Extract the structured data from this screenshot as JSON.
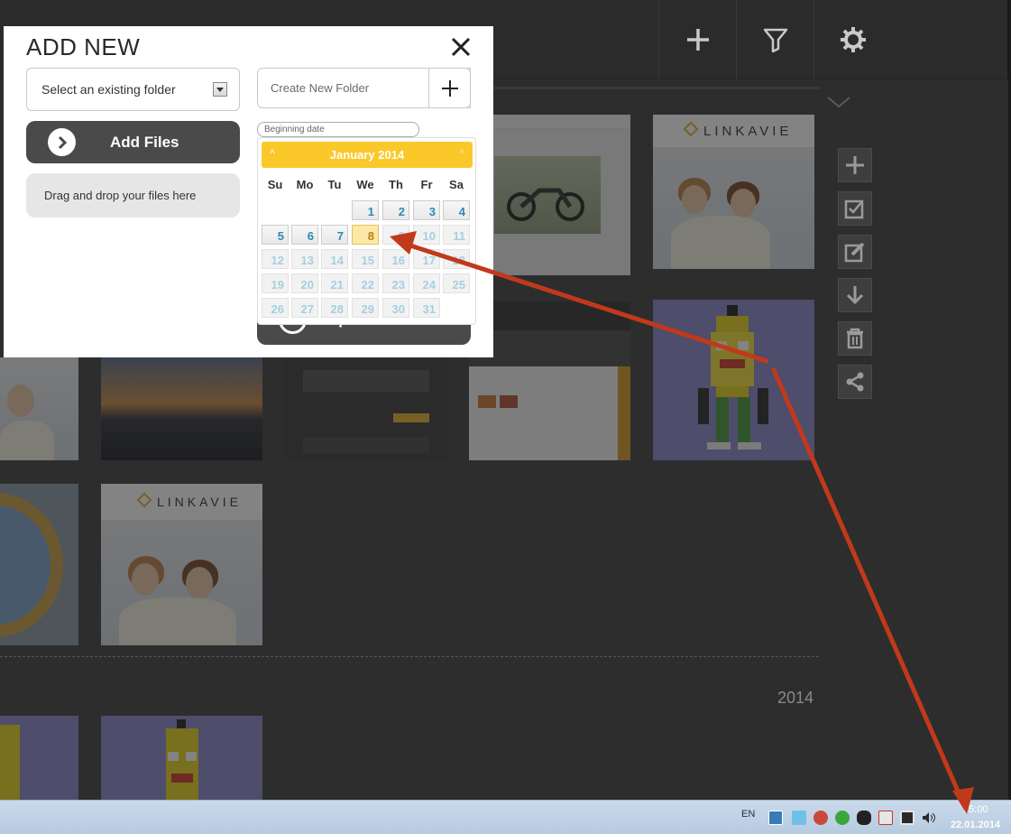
{
  "toolbar": {
    "add_icon": "plus-icon",
    "filter_icon": "filter-icon",
    "settings_icon": "gear-icon"
  },
  "modal": {
    "title": "ADD NEW",
    "folder_select_value": "Select an existing folder",
    "new_folder_placeholder": "Create New Folder",
    "add_files_label": "Add Files",
    "drop_zone_text": "Drag and drop your files here",
    "beginning_date_placeholder": "Beginning date",
    "upload_label": "Upload Files"
  },
  "datepicker": {
    "month_label": "January 2014",
    "weekdays": [
      "Su",
      "Mo",
      "Tu",
      "We",
      "Th",
      "Fr",
      "Sa"
    ],
    "first_weekday_index": 3,
    "days_in_month": 31,
    "selected_day": 8,
    "enabled_through_day": 8
  },
  "gallery": {
    "year_label": "2014"
  },
  "taskbar": {
    "language": "EN",
    "time": "15:00",
    "date": "22.01.2014"
  },
  "colors": {
    "accent": "#fbc82a",
    "annotation_arrow": "#c1391b",
    "dark_button": "#4a4a4a"
  }
}
